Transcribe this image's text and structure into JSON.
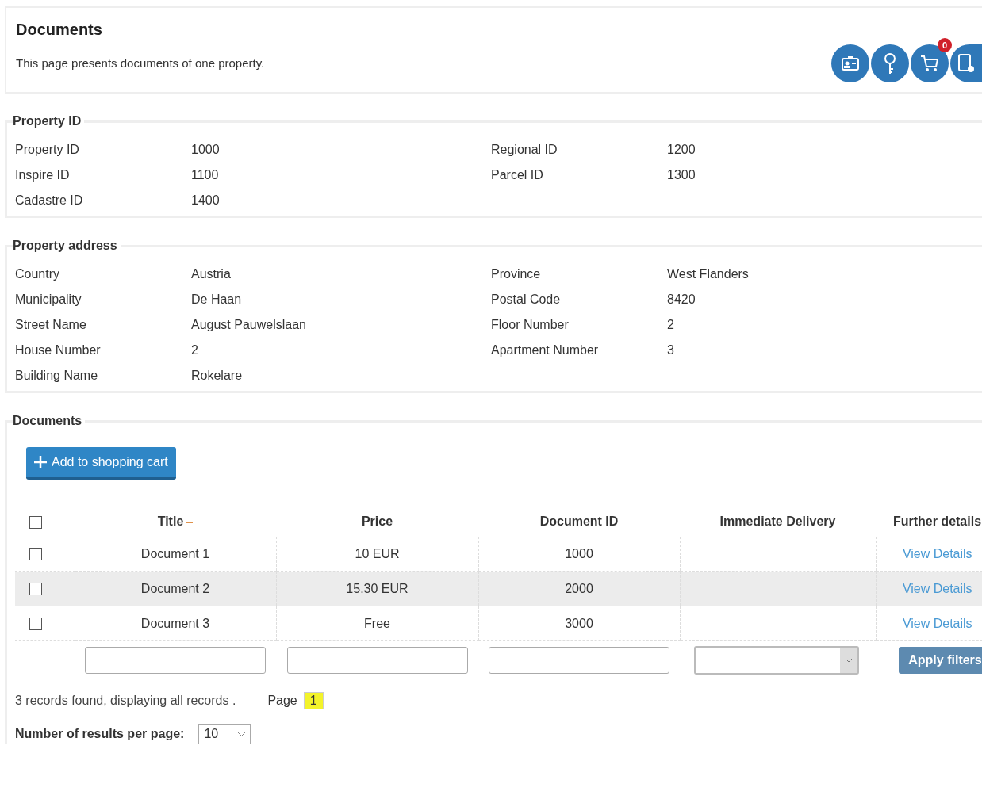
{
  "header": {
    "title": "Documents",
    "description": "This page presents documents of one property.",
    "cart_count": "0"
  },
  "sections": [
    {
      "legend": "Property ID",
      "fields": [
        {
          "label": "Property ID",
          "value": "1000"
        },
        {
          "label": "Regional ID",
          "value": "1200"
        },
        {
          "label": "Inspire ID",
          "value": "1100"
        },
        {
          "label": "Parcel ID",
          "value": "1300"
        },
        {
          "label": "Cadastre ID",
          "value": "1400"
        }
      ]
    },
    {
      "legend": "Property address",
      "fields": [
        {
          "label": "Country",
          "value": "Austria"
        },
        {
          "label": "Province",
          "value": "West Flanders"
        },
        {
          "label": "Municipality",
          "value": "De Haan"
        },
        {
          "label": "Postal Code",
          "value": "8420"
        },
        {
          "label": "Street Name",
          "value": "August Pauwelslaan"
        },
        {
          "label": "Floor Number",
          "value": "2"
        },
        {
          "label": "House Number",
          "value": "2"
        },
        {
          "label": "Apartment Number",
          "value": "3"
        },
        {
          "label": "Building Name",
          "value": "Rokelare"
        }
      ]
    }
  ],
  "documents": {
    "legend": "Documents",
    "add_button": "Add to shopping cart",
    "columns": [
      "Title",
      "Price",
      "Document ID",
      "Immediate Delivery",
      "Further details"
    ],
    "header_checked": false,
    "rows": [
      {
        "checked": false,
        "title": "Document 1",
        "price": "10 EUR",
        "document_id": "1000",
        "link": "View Details"
      },
      {
        "checked": false,
        "title": "Document 2",
        "price": "15.30 EUR",
        "document_id": "2000",
        "link": "View Details"
      },
      {
        "checked": false,
        "title": "Document 3",
        "price": "Free",
        "document_id": "3000",
        "link": "View Details"
      }
    ],
    "apply_button": "Apply filters",
    "summary": "3 records found, displaying all records .",
    "page_label": "Page",
    "pages": [
      {
        "label": "1",
        "selected": true
      }
    ],
    "per_page_label": "Number of results per page:",
    "per_page": "10"
  }
}
